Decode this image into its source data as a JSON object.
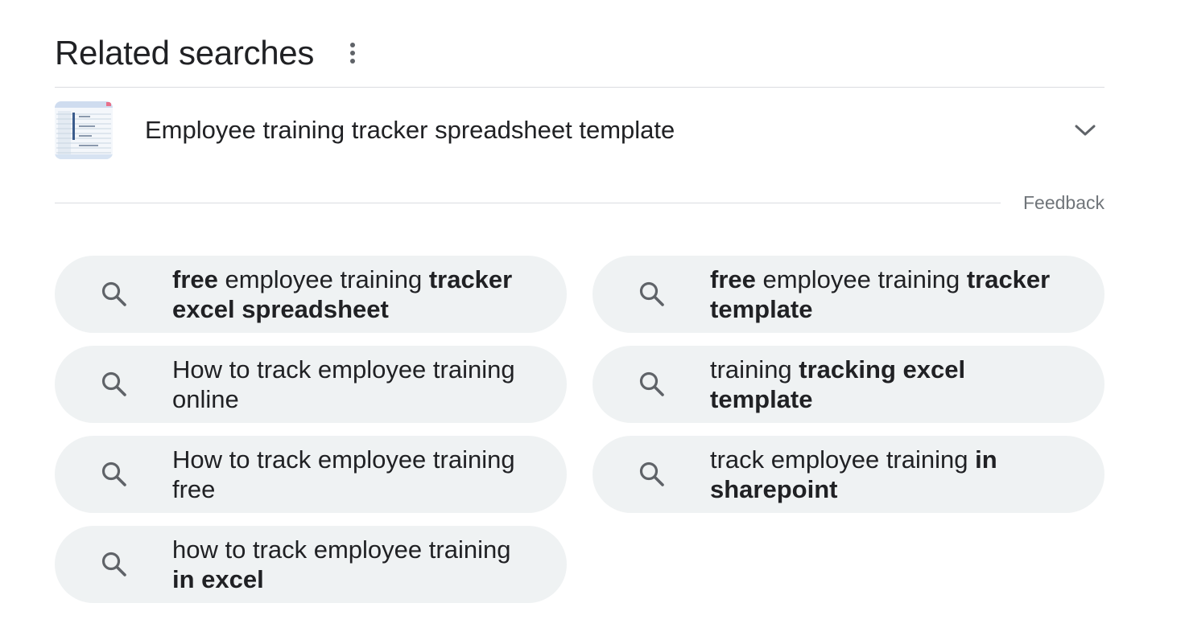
{
  "related": {
    "title": "Related searches",
    "more_icon": "more-vert-icon",
    "expandable": {
      "label": "Employee training tracker spreadsheet template",
      "thumbnail": "spreadsheet-thumbnail",
      "chevron_icon": "chevron-down-icon"
    },
    "feedback": "Feedback",
    "search_icon": "search-icon",
    "chips": [
      {
        "segments": [
          {
            "text": "free",
            "bold": true
          },
          {
            "text": " employee training ",
            "bold": false
          },
          {
            "text": "tracker excel spreadsheet",
            "bold": true
          }
        ]
      },
      {
        "segments": [
          {
            "text": "free",
            "bold": true
          },
          {
            "text": " employee training ",
            "bold": false
          },
          {
            "text": "tracker template",
            "bold": true
          }
        ]
      },
      {
        "segments": [
          {
            "text": "How to track employee training online",
            "bold": false
          }
        ]
      },
      {
        "segments": [
          {
            "text": "training ",
            "bold": false
          },
          {
            "text": "tracking excel template",
            "bold": true
          }
        ]
      },
      {
        "segments": [
          {
            "text": "How to track employee training free",
            "bold": false
          }
        ]
      },
      {
        "segments": [
          {
            "text": "track employee training ",
            "bold": false
          },
          {
            "text": "in sharepoint",
            "bold": true
          }
        ]
      },
      {
        "segments": [
          {
            "text": "how to track employee training ",
            "bold": false
          },
          {
            "text": "in excel",
            "bold": true
          }
        ]
      }
    ],
    "colors": {
      "chip_bg": "#eff2f3",
      "text": "#202124",
      "muted": "#70757a",
      "divider": "#dadce0"
    }
  }
}
